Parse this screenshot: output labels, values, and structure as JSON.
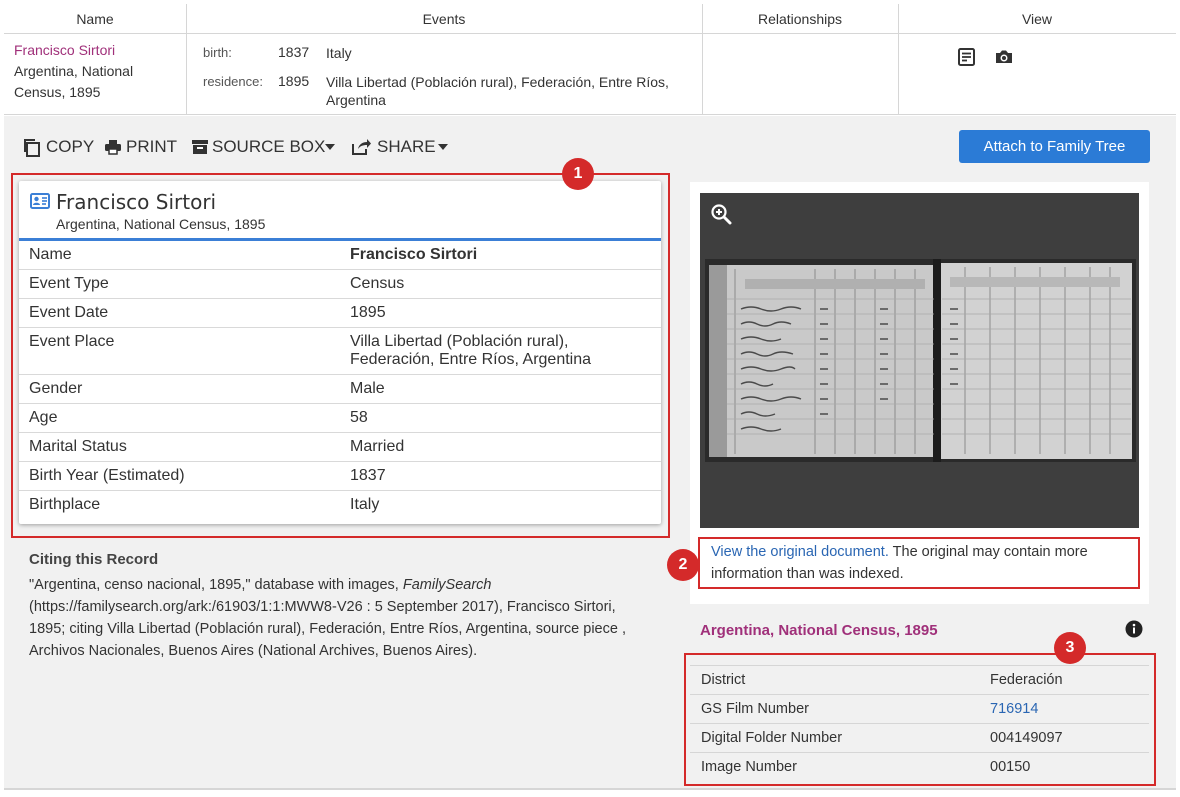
{
  "results": {
    "headers": [
      "Name",
      "Events",
      "Relationships",
      "View"
    ],
    "name_link": "Francisco Sirtori",
    "name_sub": "Argentina, National Census, 1895",
    "events": [
      {
        "label": "birth:",
        "year": "1837",
        "place": "Italy"
      },
      {
        "label": "residence:",
        "year": "1895",
        "place": "Villa Libertad (Población rural), Federación, Entre Ríos, Argentina"
      }
    ],
    "view_icons": [
      "record-icon",
      "camera-icon"
    ]
  },
  "toolbar": {
    "copy": "COPY",
    "print": "PRINT",
    "source_box": "SOURCE BOX",
    "share": "SHARE",
    "attach": "Attach to Family Tree"
  },
  "markers": [
    "1",
    "2",
    "3"
  ],
  "record": {
    "title": "Francisco Sirtori",
    "subtitle": "Argentina, National Census, 1895",
    "facts": [
      {
        "label": "Name",
        "value": "Francisco Sirtori"
      },
      {
        "label": "Event Type",
        "value": "Census"
      },
      {
        "label": "Event Date",
        "value": "1895"
      },
      {
        "label": "Event Place",
        "value": "Villa Libertad (Población rural), Federación, Entre Ríos, Argentina"
      },
      {
        "label": "Gender",
        "value": "Male"
      },
      {
        "label": "Age",
        "value": "58"
      },
      {
        "label": "Marital Status",
        "value": "Married"
      },
      {
        "label": "Birth Year (Estimated)",
        "value": "1837"
      },
      {
        "label": "Birthplace",
        "value": "Italy"
      }
    ]
  },
  "citing": {
    "heading": "Citing this Record",
    "text_before": "\"Argentina, censo nacional, 1895,\" database with images, ",
    "text_italic": "FamilySearch",
    "text_after": " (https://familysearch.org/ark:/61903/1:1:MWW8-V26 : 5 September 2017), Francisco Sirtori, 1895; citing Villa Libertad (Población rural), Federación, Entre Ríos, Argentina, source piece , Archivos Nacionales, Buenos Aires (National Archives, Buenos Aires)."
  },
  "image": {
    "view_link": "View the original document.",
    "view_note": " The original may contain more information than was indexed."
  },
  "census": {
    "title": "Argentina, National Census, 1895",
    "rows": [
      {
        "label": "District",
        "value": "Federación"
      },
      {
        "label": "GS Film Number",
        "value": "716914"
      },
      {
        "label": "Digital Folder Number",
        "value": "004149097"
      },
      {
        "label": "Image Number",
        "value": "00150"
      }
    ]
  },
  "colors": {
    "accent": "#2b7bd6",
    "name_link": "#a0307a",
    "annotation_red": "#d42a2a"
  }
}
